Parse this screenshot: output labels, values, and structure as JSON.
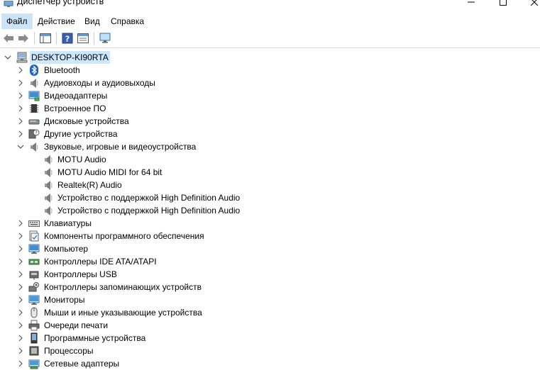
{
  "window": {
    "title": "Диспетчер устройств"
  },
  "menu": [
    {
      "label": "Файл"
    },
    {
      "label": "Действие"
    },
    {
      "label": "Вид"
    },
    {
      "label": "Справка"
    }
  ],
  "tree": {
    "root": "DESKTOP-KI90RTA",
    "categories": [
      {
        "label": "Bluetooth",
        "icon": "bluetooth-icon"
      },
      {
        "label": "Аудиовходы и аудиовыходы",
        "icon": "speaker-icon"
      },
      {
        "label": "Видеоадаптеры",
        "icon": "display-adapter-icon"
      },
      {
        "label": "Встроенное ПО",
        "icon": "firmware-chip-icon"
      },
      {
        "label": "Дисковые устройства",
        "icon": "disk-drive-icon"
      },
      {
        "label": "Другие устройства",
        "icon": "unknown-device-icon"
      },
      {
        "label": "Звуковые, игровые и видеоустройства",
        "icon": "speaker-icon",
        "expanded": true,
        "children": [
          "MOTU Audio",
          "MOTU Audio MIDI for 64 bit",
          "Realtek(R) Audio",
          "Устройство с поддержкой High Definition Audio",
          "Устройство с поддержкой High Definition Audio"
        ]
      },
      {
        "label": "Клавиатуры",
        "icon": "keyboard-icon"
      },
      {
        "label": "Компоненты программного обеспечения",
        "icon": "software-component-icon"
      },
      {
        "label": "Компьютер",
        "icon": "computer-icon"
      },
      {
        "label": "Контроллеры IDE ATA/ATAPI",
        "icon": "ide-controller-icon"
      },
      {
        "label": "Контроллеры USB",
        "icon": "usb-icon"
      },
      {
        "label": "Контроллеры запоминающих устройств",
        "icon": "storage-controller-icon"
      },
      {
        "label": "Мониторы",
        "icon": "monitor-icon"
      },
      {
        "label": "Мыши и иные указывающие устройства",
        "icon": "mouse-icon"
      },
      {
        "label": "Очереди печати",
        "icon": "printer-icon"
      },
      {
        "label": "Программные устройства",
        "icon": "software-device-icon"
      },
      {
        "label": "Процессоры",
        "icon": "processor-icon"
      },
      {
        "label": "Сетевые адаптеры",
        "icon": "network-adapter-icon"
      }
    ]
  },
  "colors": {
    "selection": "#cce8ff",
    "menu_active": "#cce4f7",
    "accent": "#0078d7"
  }
}
